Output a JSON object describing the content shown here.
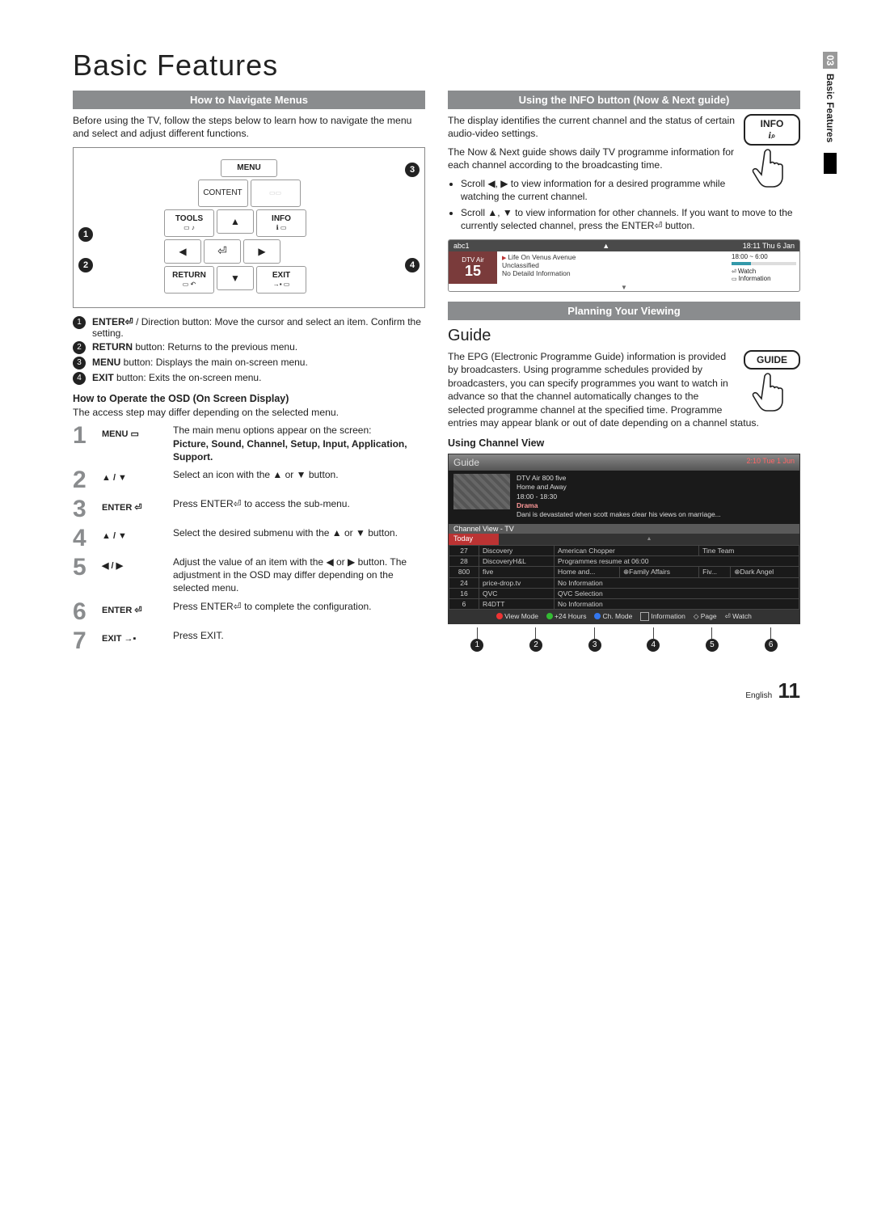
{
  "page": {
    "title": "Basic Features",
    "footer_lang": "English",
    "footer_page": "11",
    "side_chapter_num": "03",
    "side_chapter_title": "Basic Features"
  },
  "left": {
    "section1_title": "How to Navigate Menus",
    "intro": "Before using the TV, follow the steps below to learn how to navigate the menu and select and adjust different functions.",
    "remote": {
      "menu": "MENU",
      "content": "CONTENT",
      "tools": "TOOLS",
      "info": "INFO",
      "return": "RETURN",
      "exit": "EXIT"
    },
    "defs": [
      {
        "n": "1",
        "bold": "ENTER⏎",
        "rest": " / Direction button: Move the cursor and select an item. Confirm the setting."
      },
      {
        "n": "2",
        "bold": "RETURN",
        "rest": " button: Returns to the previous menu."
      },
      {
        "n": "3",
        "bold": "MENU",
        "rest": " button: Displays the main on-screen menu."
      },
      {
        "n": "4",
        "bold": "EXIT",
        "rest": " button: Exits the on-screen menu."
      }
    ],
    "osd_heading": "How to Operate the OSD (On Screen Display)",
    "osd_note": "The access step may differ depending on the selected menu.",
    "steps": [
      {
        "num": "1",
        "btn": "MENU ▭",
        "desc": "The main menu options appear on the screen:",
        "extra_bold": "Picture, Sound, Channel, Setup, Input, Application, Support."
      },
      {
        "num": "2",
        "btn": "▲ / ▼",
        "desc": "Select an icon with the ▲ or ▼ button."
      },
      {
        "num": "3",
        "btn": "ENTER ⏎",
        "desc": "Press ENTER⏎ to access the sub-menu."
      },
      {
        "num": "4",
        "btn": "▲ / ▼",
        "desc": "Select the desired submenu with the ▲ or ▼ button."
      },
      {
        "num": "5",
        "btn": "◀ / ▶",
        "desc": "Adjust the value of an item with the ◀ or ▶ button. The adjustment in the OSD may differ depending on the selected menu."
      },
      {
        "num": "6",
        "btn": "ENTER ⏎",
        "desc": "Press ENTER⏎ to complete the configuration."
      },
      {
        "num": "7",
        "btn": "EXIT →▪",
        "desc": "Press EXIT."
      }
    ]
  },
  "right": {
    "section2_title": "Using the INFO button (Now & Next guide)",
    "info_button_label": "INFO",
    "p1": "The display identifies the current channel and the status of certain audio-video settings.",
    "p2": "The Now & Next guide shows daily TV programme information for each channel according to the broadcasting time.",
    "bullets": [
      "Scroll ◀, ▶ to view information for a desired programme while watching the current channel.",
      "Scroll ▲, ▼ to view information for other channels. If you want to move to the currently selected channel, press the ENTER⏎ button."
    ],
    "info_strip": {
      "ch_label": "abc1",
      "clock": "18:11 Thu 6 Jan",
      "service": "DTV Air",
      "ch_num": "15",
      "prog_title": "Life On Venus Avenue",
      "rating": "Unclassified",
      "detail": "No Detaild Information",
      "time_range": "18:00 ~ 6:00",
      "act_watch": "Watch",
      "act_info": "Information"
    },
    "section3_title": "Planning Your Viewing",
    "guide_heading": "Guide",
    "guide_button_label": "GUIDE",
    "guide_para": "The EPG (Electronic Programme Guide) information is provided by broadcasters. Using programme schedules provided by broadcasters, you can specify programmes you want to watch in advance so that the channel automatically changes to the selected programme channel at the specified time. Programme entries may appear blank or out of date depending on a channel status.",
    "using_channel_view": "Using  Channel View",
    "epg": {
      "title": "Guide",
      "clock": "2:10 Tue 1 Jun",
      "prog_service": "DTV Air 800 five",
      "prog_name": "Home and Away",
      "prog_time": "18:00 - 18:30",
      "prog_genre": "Drama",
      "prog_synopsis": "Dani is devastated when scott makes clear his views on marriage...",
      "view_label": "Channel View - TV",
      "today": "Today",
      "rows": [
        {
          "num": "27",
          "name": "Discovery",
          "cells": [
            "American Chopper",
            "Tine Team"
          ]
        },
        {
          "num": "28",
          "name": "DiscoveryH&L",
          "cells": [
            "Programmes resume at 06:00"
          ]
        },
        {
          "num": "800",
          "name": "five",
          "cells": [
            "Home and...",
            "⊕Family Affairs",
            "Fiv...",
            "⊕Dark Angel"
          ]
        },
        {
          "num": "24",
          "name": "price-drop.tv",
          "cells": [
            "No Information"
          ]
        },
        {
          "num": "16",
          "name": "QVC",
          "cells": [
            "QVC Selection"
          ]
        },
        {
          "num": "6",
          "name": "R4DTT",
          "cells": [
            "No Information"
          ]
        }
      ],
      "footer": {
        "view_mode": "View Mode",
        "hours": "+24 Hours",
        "ch_mode": "Ch. Mode",
        "information": "Information",
        "page": "Page",
        "watch": "Watch"
      }
    }
  }
}
